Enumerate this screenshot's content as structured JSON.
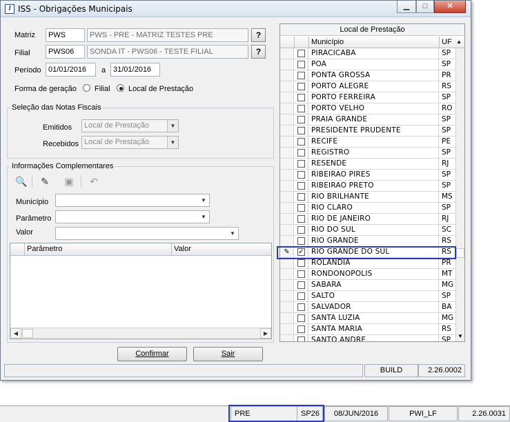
{
  "window": {
    "title": "ISS - Obrigações Municipais",
    "icon": "I"
  },
  "form": {
    "matriz_label": "Matriz",
    "matriz_code": "PWS",
    "matriz_desc": "PWS - PRE  - MATRIZ TESTES PRE",
    "filial_label": "Filial",
    "filial_code": "PWS06",
    "filial_desc": "SONDA IT - PWS06 - TESTE FILIAL",
    "lookup_label": "?",
    "periodo_label": "Período",
    "periodo_start": "01/01/2016",
    "periodo_sep": "a",
    "periodo_end": "31/01/2016",
    "forma_label": "Forma de geração",
    "forma_opt1": "Filial",
    "forma_opt2": "Local de Prestação"
  },
  "selecao": {
    "legend": "Seleção das Notas Fiscais",
    "emitidos_label": "Emitidos",
    "emitidos_value": "Local de Prestação",
    "recebidos_label": "Recebidos",
    "recebidos_value": "Local de Prestação"
  },
  "info": {
    "legend": "Informações Complementares",
    "municipio_label": "Município",
    "parametro_label": "Parâmetro",
    "valor_label": "Valor",
    "grid_col1": "Parâmetro",
    "grid_col2": "Valor"
  },
  "buttons": {
    "confirmar": "Confirmar",
    "sair": "Sair"
  },
  "right_grid": {
    "title": "Local de Prestação",
    "col_municipio": "Município",
    "col_uf": "UF",
    "rows": [
      {
        "m": "PIRACICABA",
        "uf": "SP",
        "checked": false
      },
      {
        "m": "POA",
        "uf": "SP",
        "checked": false
      },
      {
        "m": "PONTA GROSSA",
        "uf": "PR",
        "checked": false
      },
      {
        "m": "PORTO ALEGRE",
        "uf": "RS",
        "checked": false
      },
      {
        "m": "PORTO FERREIRA",
        "uf": "SP",
        "checked": false
      },
      {
        "m": "PORTO VELHO",
        "uf": "RO",
        "checked": false
      },
      {
        "m": "PRAIA GRANDE",
        "uf": "SP",
        "checked": false
      },
      {
        "m": "PRESIDENTE PRUDENTE",
        "uf": "SP",
        "checked": false
      },
      {
        "m": "RECIFE",
        "uf": "PE",
        "checked": false
      },
      {
        "m": "REGISTRO",
        "uf": "SP",
        "checked": false
      },
      {
        "m": "RESENDE",
        "uf": "RJ",
        "checked": false
      },
      {
        "m": "RIBEIRAO PIRES",
        "uf": "SP",
        "checked": false
      },
      {
        "m": "RIBEIRAO PRETO",
        "uf": "SP",
        "checked": false
      },
      {
        "m": "RIO BRILHANTE",
        "uf": "MS",
        "checked": false
      },
      {
        "m": "RIO CLARO",
        "uf": "SP",
        "checked": false
      },
      {
        "m": "RIO DE JANEIRO",
        "uf": "RJ",
        "checked": false
      },
      {
        "m": "RIO DO SUL",
        "uf": "SC",
        "checked": false
      },
      {
        "m": "RIO GRANDE",
        "uf": "RS",
        "checked": false
      },
      {
        "m": "RIO GRANDE DO SUL",
        "uf": "RS",
        "checked": true,
        "editing": true
      },
      {
        "m": "ROLANDIA",
        "uf": "PR",
        "checked": false
      },
      {
        "m": "RONDONOPOLIS",
        "uf": "MT",
        "checked": false
      },
      {
        "m": "SABARA",
        "uf": "MG",
        "checked": false
      },
      {
        "m": "SALTO",
        "uf": "SP",
        "checked": false
      },
      {
        "m": "SALVADOR",
        "uf": "BA",
        "checked": false
      },
      {
        "m": "SANTA LUZIA",
        "uf": "MG",
        "checked": false
      },
      {
        "m": "SANTA MARIA",
        "uf": "RS",
        "checked": false
      },
      {
        "m": "SANTO ANDRE",
        "uf": "SP",
        "checked": false
      }
    ]
  },
  "window_status": {
    "build_label": "BUILD",
    "build_value": "2.26.0002"
  },
  "bottom_bar": {
    "company": "PRE",
    "code": "SP26",
    "date": "08/JUN/2016",
    "system": "PWI_LF",
    "version": "2.26.0031"
  },
  "icons": {
    "search": "binoculars-icon",
    "edit": "edit-icon",
    "save": "save-icon",
    "undo": "undo-icon"
  },
  "colors": {
    "highlight": "#2b3cb5"
  }
}
